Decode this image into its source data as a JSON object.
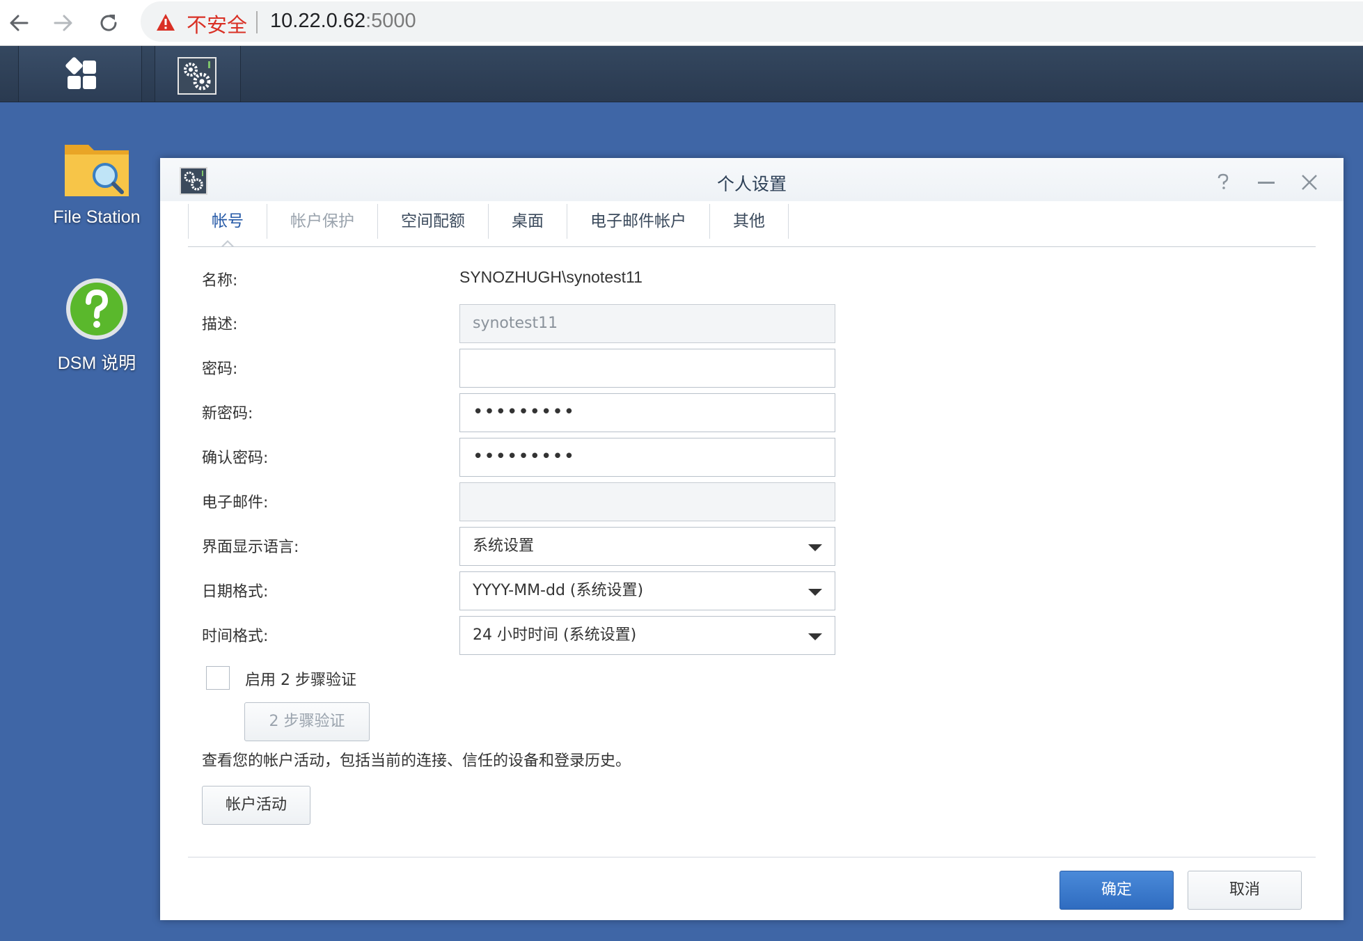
{
  "browser": {
    "security_label": "不安全",
    "url_host": "10.22.0.62",
    "url_port": ":5000"
  },
  "desktop": {
    "icons": [
      {
        "label": "File Station"
      },
      {
        "label": "DSM 说明"
      }
    ]
  },
  "window": {
    "title": "个人设置",
    "tabs": [
      {
        "label": "帐号",
        "state": "active"
      },
      {
        "label": "帐户保护",
        "state": "disabled"
      },
      {
        "label": "空间配额",
        "state": "normal"
      },
      {
        "label": "桌面",
        "state": "normal"
      },
      {
        "label": "电子邮件帐户",
        "state": "normal"
      },
      {
        "label": "其他",
        "state": "normal"
      }
    ],
    "form": {
      "name_label": "名称:",
      "name_value": "SYNOZHUGH\\synotest11",
      "desc_label": "描述:",
      "desc_value": "synotest11",
      "password_label": "密码:",
      "password_value": "",
      "new_password_label": "新密码:",
      "new_password_value": "•••••••••",
      "confirm_password_label": "确认密码:",
      "confirm_password_value": "•••••••••",
      "email_label": "电子邮件:",
      "email_value": "",
      "language_label": "界面显示语言:",
      "language_value": "系统设置",
      "date_label": "日期格式:",
      "date_value": "YYYY-MM-dd (系统设置)",
      "time_label": "时间格式:",
      "time_value": "24 小时时间 (系统设置)"
    },
    "two_step": {
      "checkbox_label": "启用 2 步骤验证",
      "checked": false,
      "button_label": "2 步骤验证"
    },
    "activity": {
      "description": "查看您的帐户活动，包括当前的连接、信任的设备和登录历史。",
      "button_label": "帐户活动"
    },
    "footer": {
      "ok_label": "确定",
      "cancel_label": "取消"
    }
  },
  "colors": {
    "desktop_bg": "#3f66a6",
    "primary_button": "#2f6cc0",
    "active_tab": "#2458a6",
    "insecure_red": "#d93025"
  }
}
